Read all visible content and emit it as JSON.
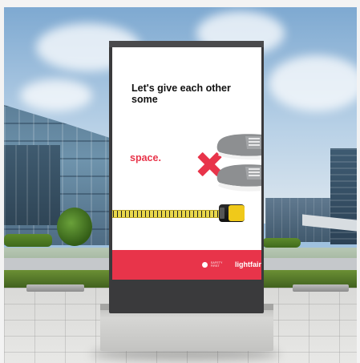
{
  "poster": {
    "headline": "Let's give each other some",
    "accent_word": "space.",
    "brand_small": "SAFETY FIRST",
    "brand_name": "lightfair"
  },
  "colors": {
    "accent": "#e8344a",
    "kiosk": "#3a3a3c"
  }
}
